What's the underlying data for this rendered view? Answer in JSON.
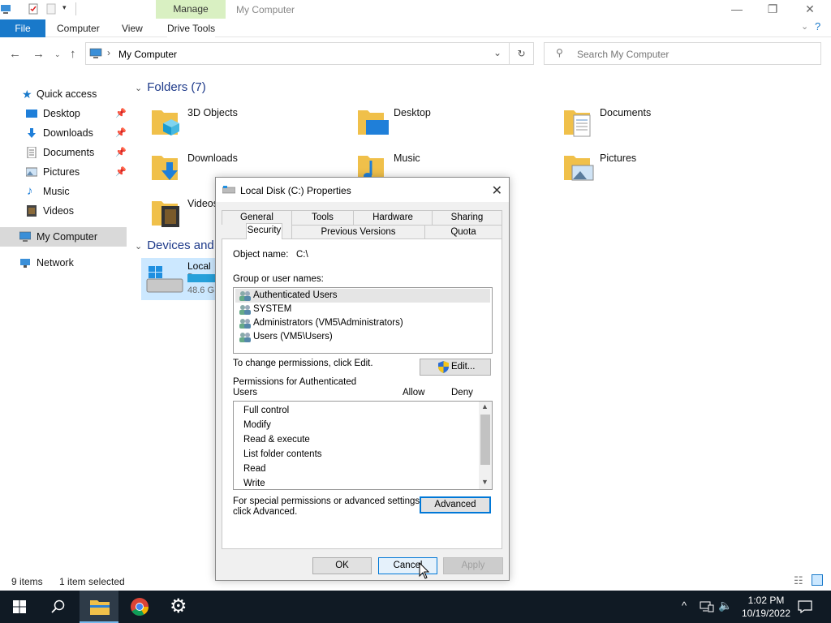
{
  "window": {
    "title": "My Computer",
    "ribbon_context": "Manage",
    "tabs": [
      "File",
      "Computer",
      "View",
      "Drive Tools"
    ]
  },
  "address": {
    "path": "My Computer",
    "search_placeholder": "Search My Computer"
  },
  "sidebar": {
    "quick_access": "Quick access",
    "items": [
      {
        "label": "Desktop",
        "icon": "desktop-icon",
        "pinned": true
      },
      {
        "label": "Downloads",
        "icon": "downloads-icon",
        "pinned": true
      },
      {
        "label": "Documents",
        "icon": "documents-icon",
        "pinned": true
      },
      {
        "label": "Pictures",
        "icon": "pictures-icon",
        "pinned": true
      },
      {
        "label": "Music",
        "icon": "music-icon",
        "pinned": false
      },
      {
        "label": "Videos",
        "icon": "videos-icon",
        "pinned": false
      }
    ],
    "my_computer": "My Computer",
    "network": "Network"
  },
  "content": {
    "folders_header": "Folders (7)",
    "folders": [
      "3D Objects",
      "Desktop",
      "Documents",
      "Downloads",
      "Music",
      "Pictures",
      "Videos"
    ],
    "devices_header": "Devices and",
    "drive_label": "Local D",
    "drive_free": "48.6 G",
    "drive_used_fraction": 0.3
  },
  "dialog": {
    "title": "Local Disk (C:) Properties",
    "tabs_row1": [
      "General",
      "Tools",
      "Hardware",
      "Sharing"
    ],
    "tabs_row2": [
      "Security",
      "Previous Versions",
      "Quota"
    ],
    "object_name_label": "Object name:",
    "object_name_value": "C:\\",
    "group_label": "Group or user names:",
    "users": [
      "Authenticated Users",
      "SYSTEM",
      "Administrators (VM5\\Administrators)",
      "Users (VM5\\Users)"
    ],
    "change_text": "To change permissions, click Edit.",
    "edit_button": "Edit...",
    "perm_label_line1": "Permissions for Authenticated",
    "perm_label_line2": "Users",
    "allow_header": "Allow",
    "deny_header": "Deny",
    "permissions": [
      "Full control",
      "Modify",
      "Read & execute",
      "List folder contents",
      "Read",
      "Write"
    ],
    "special_line1": "For special permissions or advanced settings,",
    "special_line2": "click Advanced.",
    "advanced_button": "Advanced",
    "ok_button": "OK",
    "cancel_button": "Cancel",
    "apply_button": "Apply"
  },
  "status": {
    "items_count": "9 items",
    "selection": "1 item selected"
  },
  "taskbar": {
    "time": "1:02 PM",
    "date": "10/19/2022"
  },
  "colors": {
    "accent": "#1979ca",
    "manage_tab": "#d9f0c2",
    "taskbar": "#101a24",
    "folder": "#f0c04a"
  }
}
